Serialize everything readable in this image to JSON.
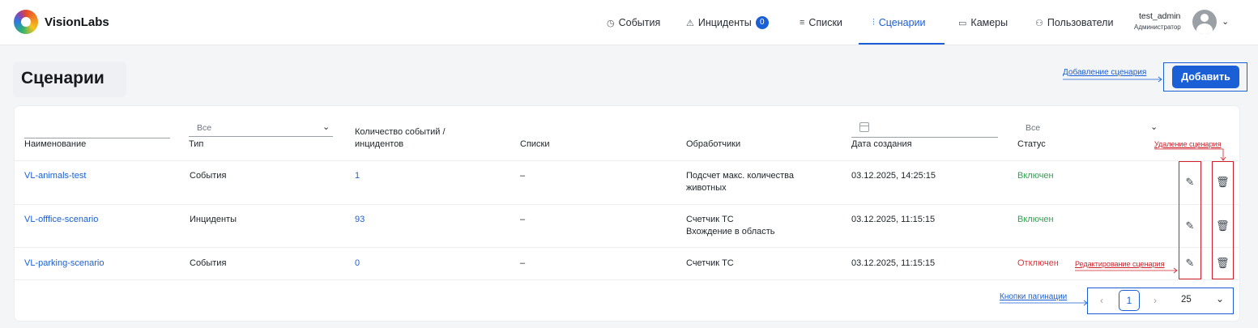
{
  "header": {
    "brand": "VisionLabs",
    "nav": [
      {
        "icon": "clock-icon",
        "glyph": "◷",
        "label": "События"
      },
      {
        "icon": "warning-icon",
        "glyph": "⚠",
        "label": "Инциденты",
        "badge": "0"
      },
      {
        "icon": "list-icon",
        "glyph": "≡",
        "label": "Списки"
      },
      {
        "icon": "sliders-icon",
        "glyph": "⫶",
        "label": "Сценарии",
        "active": true
      },
      {
        "icon": "camera-icon",
        "glyph": "▭",
        "label": "Камеры"
      },
      {
        "icon": "users-icon",
        "glyph": "⚇",
        "label": "Пользователи"
      }
    ],
    "user": {
      "name": "test_admin",
      "role": "Администратор"
    }
  },
  "page": {
    "title": "Сценарии",
    "add_button": "Добавить"
  },
  "annotations": {
    "add": "Добавление сценария",
    "delete": "Удаление сценария",
    "edit": "Редактирование сценария",
    "pagination": "Кнопки пагинации"
  },
  "table": {
    "columns": {
      "name": "Наименование",
      "type": "Тип",
      "count_line1": "Количество событий /",
      "count_line2": "инцидентов",
      "lists": "Списки",
      "handlers": "Обработчики",
      "created": "Дата создания",
      "status": "Статус"
    },
    "filters": {
      "type": "Все",
      "status": "Все"
    },
    "rows": [
      {
        "name": "VL-animals-test",
        "type": "События",
        "count": "1",
        "lists": "–",
        "handlers_1": "Подсчет макс. количества",
        "handlers_2": "животных",
        "created": "03.12.2025, 14:25:15",
        "status": "Включен"
      },
      {
        "name": "VL-offfice-scenario",
        "type": "Инциденты",
        "count": "93",
        "lists": "–",
        "handlers_1": "Счетчик ТС",
        "handlers_2": "Вхождение в область",
        "created": "03.12.2025, 11:15:15",
        "status": "Включен"
      },
      {
        "name": "VL-parking-scenario",
        "type": "События",
        "count": "0",
        "lists": "–",
        "handlers_1": "Счетчик ТС",
        "handlers_2": "",
        "created": "03.12.2025, 11:15:15",
        "status": "Отключен"
      }
    ]
  },
  "pagination": {
    "current_page": "1",
    "page_size": "25"
  },
  "colors": {
    "accent": "#1a5fd6",
    "enabled": "#2ea44f",
    "disabled": "#e0323a",
    "annotation_red": "#d0202a"
  }
}
